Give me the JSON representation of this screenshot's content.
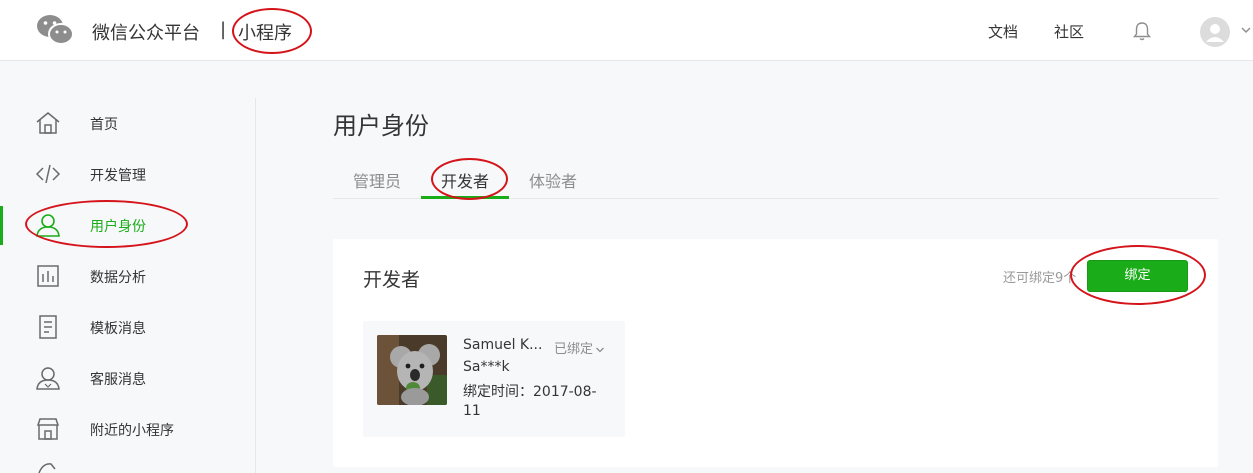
{
  "header": {
    "brand": "微信公众平台",
    "separator": "|",
    "product": "小程序",
    "links": {
      "docs": "文档",
      "community": "社区"
    }
  },
  "sidebar": {
    "items": [
      {
        "label": "首页",
        "icon": "home-icon"
      },
      {
        "label": "开发管理",
        "icon": "code-icon"
      },
      {
        "label": "用户身份",
        "icon": "user-icon",
        "active": true
      },
      {
        "label": "数据分析",
        "icon": "bar-chart-icon"
      },
      {
        "label": "模板消息",
        "icon": "document-icon"
      },
      {
        "label": "客服消息",
        "icon": "support-user-icon"
      },
      {
        "label": "附近的小程序",
        "icon": "shop-icon"
      }
    ]
  },
  "main": {
    "title": "用户身份",
    "tabs": [
      {
        "label": "管理员"
      },
      {
        "label": "开发者",
        "active": true
      },
      {
        "label": "体验者"
      }
    ],
    "panel": {
      "title": "开发者",
      "remaining": "还可绑定9个",
      "bind_button": "绑定",
      "member": {
        "name": "Samuel K...",
        "status": "已绑定",
        "account": "Sa***k",
        "bind_time_label": "绑定时间：2017-08-",
        "bind_time_value": "11"
      }
    }
  },
  "colors": {
    "accent": "#1aad19",
    "annotation": "#d4141a"
  }
}
